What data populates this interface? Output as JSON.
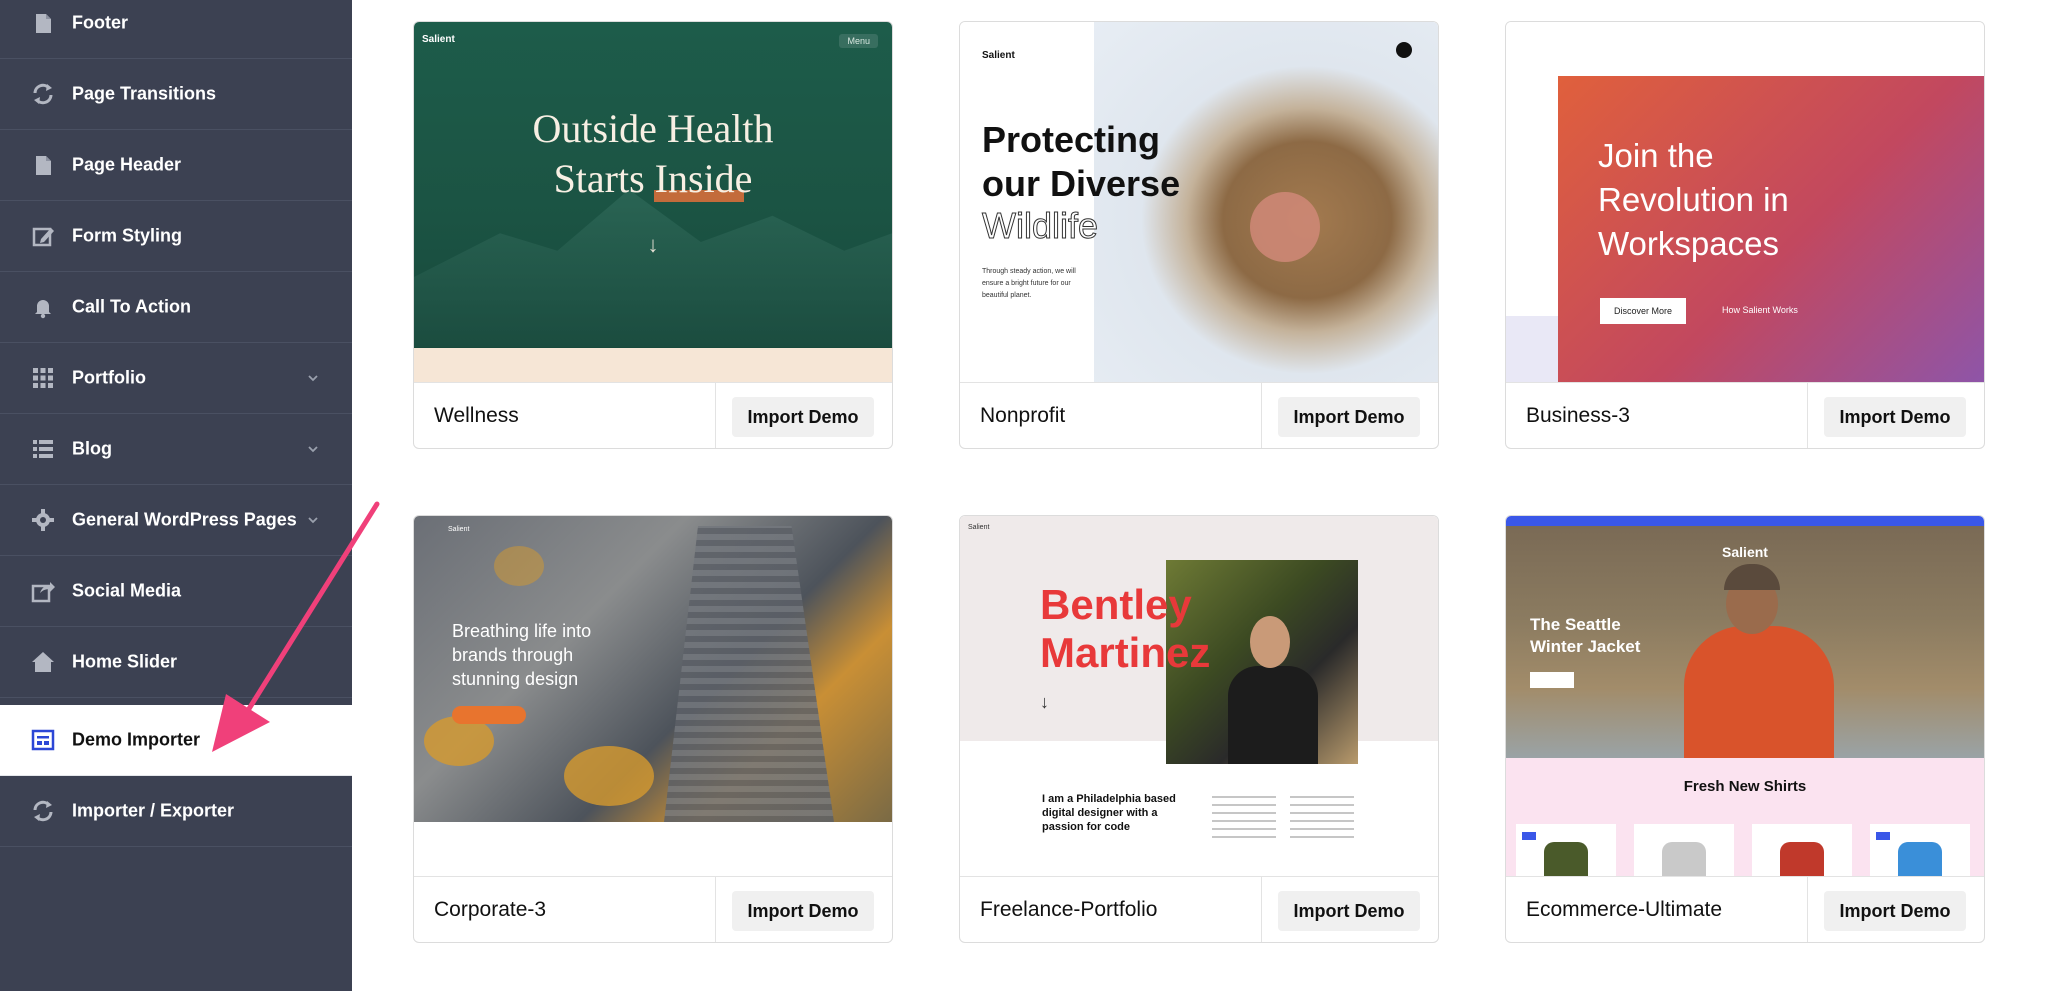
{
  "sidebar": {
    "items": [
      {
        "label": "Footer",
        "icon": "document-icon"
      },
      {
        "label": "Page Transitions",
        "icon": "refresh-icon"
      },
      {
        "label": "Page Header",
        "icon": "document-icon"
      },
      {
        "label": "Form Styling",
        "icon": "edit-icon"
      },
      {
        "label": "Call To Action",
        "icon": "bell-icon"
      },
      {
        "label": "Portfolio",
        "icon": "grid-icon"
      },
      {
        "label": "Blog",
        "icon": "list-icon"
      },
      {
        "label": "General WordPress Pages",
        "icon": "gear-icon"
      },
      {
        "label": "Social Media",
        "icon": "share-icon"
      },
      {
        "label": "Home Slider",
        "icon": "home-icon"
      },
      {
        "label": "Demo Importer",
        "icon": "layout-icon"
      },
      {
        "label": "Importer / Exporter",
        "icon": "refresh-icon"
      }
    ],
    "active": "Demo Importer"
  },
  "demos": [
    {
      "name": "Wellness",
      "button": "Import Demo",
      "preview": {
        "brand": "Salient",
        "menu": "Menu",
        "headline_1": "Outside Health",
        "headline_2": "Starts Inside",
        "arrow": "↓"
      }
    },
    {
      "name": "Nonprofit",
      "button": "Import Demo",
      "preview": {
        "brand": "Salient",
        "h1": "Protecting",
        "h2": "our Diverse",
        "h3": "Wildlife",
        "body": "Through steady action, we will ensure a bright future for our beautiful planet."
      }
    },
    {
      "name": "Business-3",
      "button": "Import Demo",
      "preview": {
        "t1": "Join the",
        "t2": "Revolution in",
        "t3": "Workspaces",
        "cta": "Discover More",
        "link": "How Salient Works"
      }
    },
    {
      "name": "Corporate-3",
      "button": "Import Demo",
      "preview": {
        "brand": "Salient",
        "t1": "Breathing life into",
        "t2": "brands through",
        "t3": "stunning design"
      }
    },
    {
      "name": "Freelance-Portfolio",
      "button": "Import Demo",
      "preview": {
        "brand": "Salient",
        "n1": "Bentley",
        "n2": "Martinez",
        "arrow": "↓",
        "bio": "I am a Philadelphia based digital designer with a passion for code"
      }
    },
    {
      "name": "Ecommerce-Ultimate",
      "button": "Import Demo",
      "preview": {
        "brand": "Salient",
        "j1": "The Seattle",
        "j2": "Winter Jacket",
        "section": "Fresh New Shirts"
      }
    }
  ],
  "colors": {
    "sidebar_bg": "#3c4152",
    "active_bg": "#ffffff",
    "pointer_arrow": "#f0407a",
    "active_icon": "#2c47d6"
  }
}
